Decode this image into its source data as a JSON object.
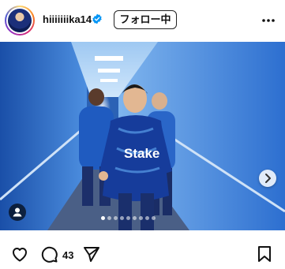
{
  "post": {
    "username": "hiiiiiiika14",
    "verified": true,
    "follow_label": "フォロー中",
    "comment_count": "43"
  },
  "photo": {
    "kit_sponsor": "Stake",
    "carousel_total": 9,
    "carousel_active": 1
  },
  "icons": {
    "verified": "verified-badge-icon",
    "more": "more-options-icon",
    "next": "chevron-right-icon",
    "tag": "user-tag-icon",
    "like": "heart-icon",
    "comment": "comment-icon",
    "share": "paper-plane-icon",
    "save": "bookmark-icon"
  },
  "colors": {
    "verified": "#0095f6",
    "photo_blue": "#2a64b8"
  }
}
